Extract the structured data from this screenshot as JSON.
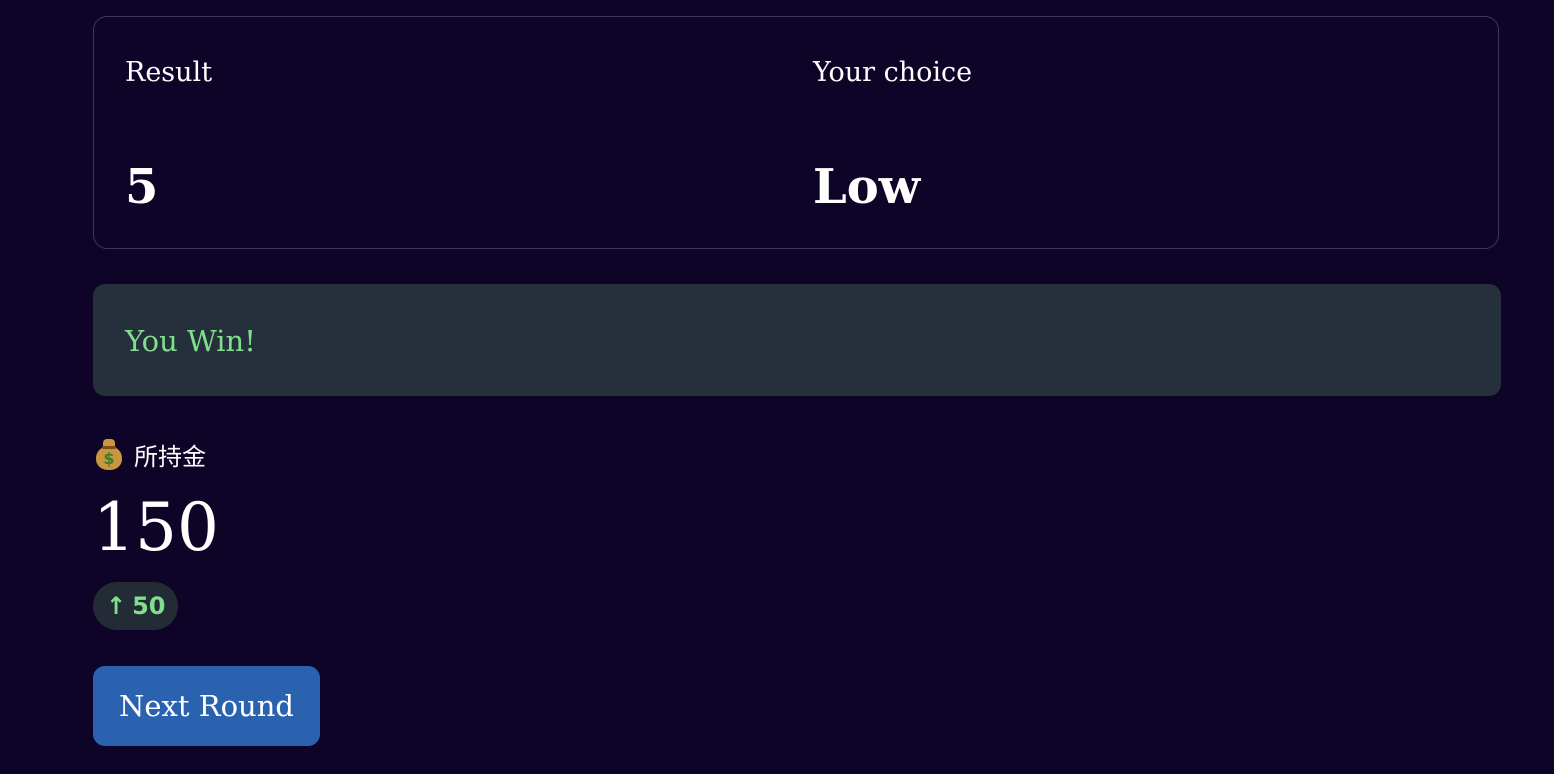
{
  "result_card": {
    "result_label": "Result",
    "result_value": "5",
    "choice_label": "Your choice",
    "choice_value": "Low"
  },
  "outcome": {
    "message": "You Win!",
    "color": "#7fdf8a"
  },
  "balance": {
    "icon": "moneybag-icon",
    "label": "所持金",
    "value": "150",
    "delta_icon": "arrow-up-icon",
    "delta_arrow": "↑",
    "delta_value": "50"
  },
  "actions": {
    "next_round_label": "Next Round"
  },
  "colors": {
    "background": "#0e0428",
    "card_border": "#3f3560",
    "banner_background": "#25303c",
    "win_green": "#7fdf8a",
    "button_blue": "#2b62b0"
  }
}
